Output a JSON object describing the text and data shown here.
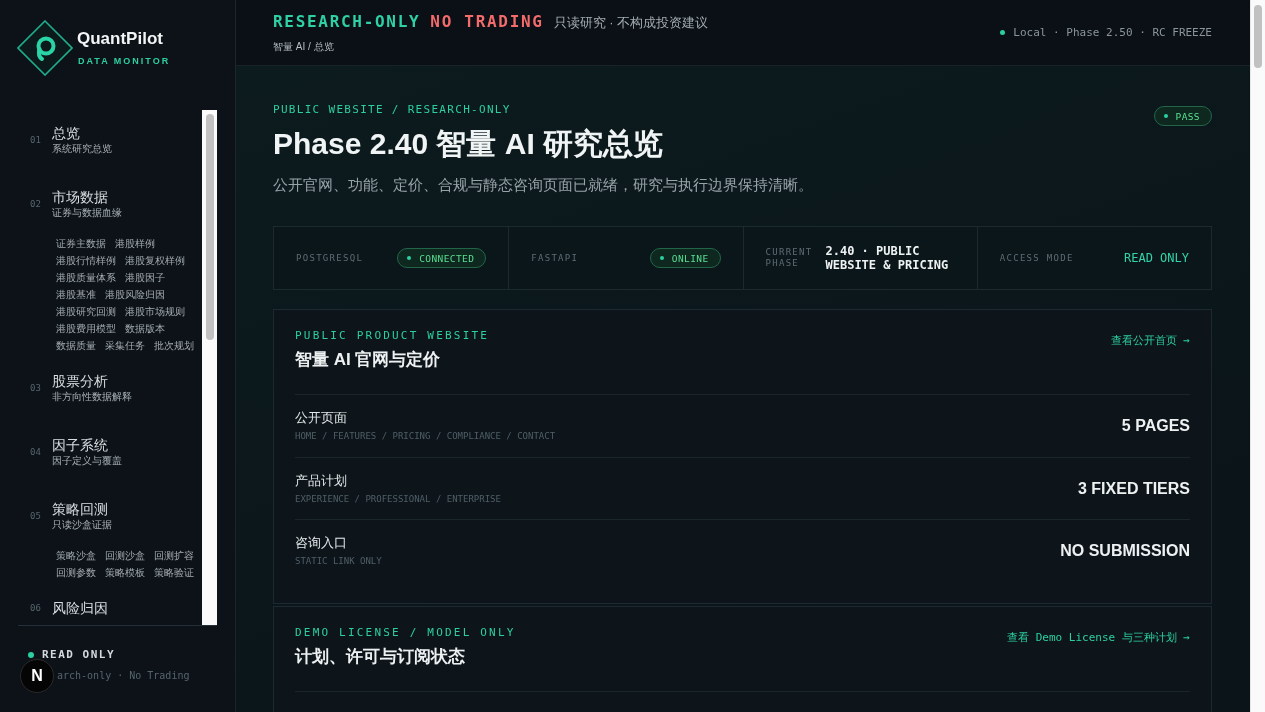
{
  "sidebar": {
    "brand": {
      "name": "QuantPilot",
      "tagline": "DATA MONITOR"
    },
    "nav": [
      {
        "number": "01",
        "title": "总览",
        "subtitle": "系统研究总览"
      },
      {
        "number": "02",
        "title": "市场数据",
        "subtitle": "证券与数据血缘",
        "links": [
          "证券主数据",
          "港股样例",
          "港股行情样例",
          "港股复权样例",
          "港股质量体系",
          "港股因子",
          "港股基准",
          "港股风险归因",
          "港股研究回测",
          "港股市场规则",
          "港股费用模型",
          "数据版本",
          "数据质量",
          "采集任务",
          "批次规划"
        ]
      },
      {
        "number": "03",
        "title": "股票分析",
        "subtitle": "非方向性数据解释"
      },
      {
        "number": "04",
        "title": "因子系统",
        "subtitle": "因子定义与覆盖"
      },
      {
        "number": "05",
        "title": "策略回测",
        "subtitle": "只读沙盒证据",
        "links": [
          "策略沙盒",
          "回测沙盒",
          "回测扩容",
          "回测参数",
          "策略模板",
          "策略验证"
        ]
      },
      {
        "number": "06",
        "title": "风险归因"
      }
    ],
    "footer": {
      "mode": "READ ONLY",
      "note": "arch-only · No Trading"
    },
    "dev_badge": {
      "label": "N"
    }
  },
  "header": {
    "badges": [
      {
        "text": "RESEARCH-ONLY",
        "color": "#2fd1a4"
      },
      {
        "text": "NO TRADING",
        "color": "#f36b6b"
      }
    ],
    "tagline": "只读研究 · 不构成投资建议",
    "breadcrumb": "智量 AI / 总览",
    "environment": "Local · Phase 2.50 · RC FREEZE"
  },
  "hero": {
    "eyebrow": "PUBLIC WEBSITE / RESEARCH-ONLY",
    "title": "Phase 2.40 智量 AI 研究总览",
    "subtitle": "公开官网、功能、定价、合规与静态咨询页面已就绪，研究与执行边界保持清晰。",
    "status": "PASS"
  },
  "status_strip": [
    {
      "kind": "pill",
      "label": "POSTGRESQL",
      "value": "CONNECTED"
    },
    {
      "kind": "pill",
      "label": "FASTAPI",
      "value": "ONLINE"
    },
    {
      "kind": "text",
      "label": "CURRENT PHASE",
      "value": "2.40 · PUBLIC WEBSITE & PRICING"
    },
    {
      "kind": "accent",
      "label": "ACCESS MODE",
      "value": "READ ONLY"
    }
  ],
  "cards": [
    {
      "eyebrow": "PUBLIC PRODUCT WEBSITE",
      "title": "智量 AI 官网与定价",
      "link": "查看公开首页 →",
      "rows": [
        {
          "label": "公开页面",
          "detail": "HOME / FEATURES / PRICING / COMPLIANCE / CONTACT",
          "value": "5 PAGES"
        },
        {
          "label": "产品计划",
          "detail": "EXPERIENCE / PROFESSIONAL / ENTERPRISE",
          "value": "3 FIXED TIERS"
        },
        {
          "label": "咨询入口",
          "detail": "STATIC LINK ONLY",
          "value": "NO SUBMISSION"
        }
      ]
    },
    {
      "eyebrow": "DEMO LICENSE / MODEL ONLY",
      "title": "计划、许可与订阅状态",
      "link": "查看 Demo License 与三种计划 →"
    }
  ]
}
